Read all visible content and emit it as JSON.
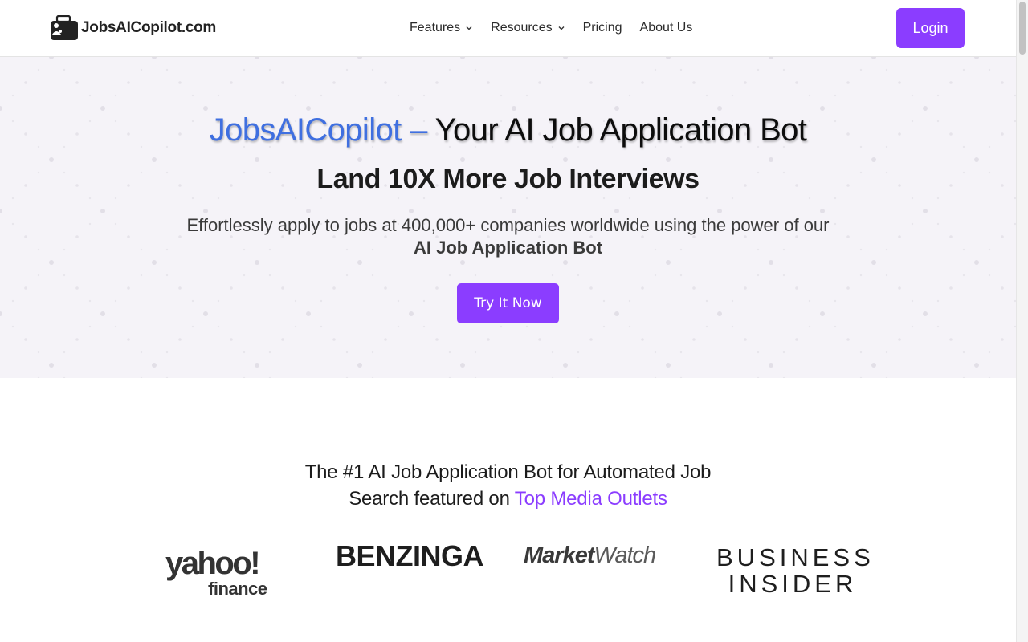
{
  "header": {
    "logo_text": "JobsAICopilot.com",
    "nav": [
      {
        "label": "Features",
        "has_dropdown": true
      },
      {
        "label": "Resources",
        "has_dropdown": true
      },
      {
        "label": "Pricing",
        "has_dropdown": false
      },
      {
        "label": "About Us",
        "has_dropdown": false
      }
    ],
    "login_label": "Login"
  },
  "hero": {
    "title_brand": "JobsAICopilot –",
    "title_rest": "Your AI Job Application Bot",
    "subtitle": "Land 10X More Job Interviews",
    "description": "Effortlessly apply to jobs at 400,000+ companies worldwide using the power of our",
    "description_bold": "AI Job Application Bot",
    "cta_label": "Try It Now"
  },
  "featured": {
    "line1": "The #1 AI Job Application Bot for Automated Job",
    "line2_prefix": "Search featured on",
    "line2_accent": "Top Media Outlets",
    "media_logos": [
      {
        "name": "yahoo-finance",
        "text_top": "yahoo!",
        "text_bottom": "finance"
      },
      {
        "name": "benzinga",
        "text": "BENZINGA"
      },
      {
        "name": "marketwatch",
        "text_a": "Market",
        "text_b": "Watch"
      },
      {
        "name": "business-insider",
        "text_top": "BUSINESS",
        "text_bottom": "INSIDER"
      }
    ]
  },
  "colors": {
    "accent": "#8b3dff",
    "brand_blue": "#3f6fe0",
    "hero_bg": "#f5f3f8"
  },
  "icons": [
    "briefcase-logo-icon",
    "chevron-down-icon"
  ]
}
